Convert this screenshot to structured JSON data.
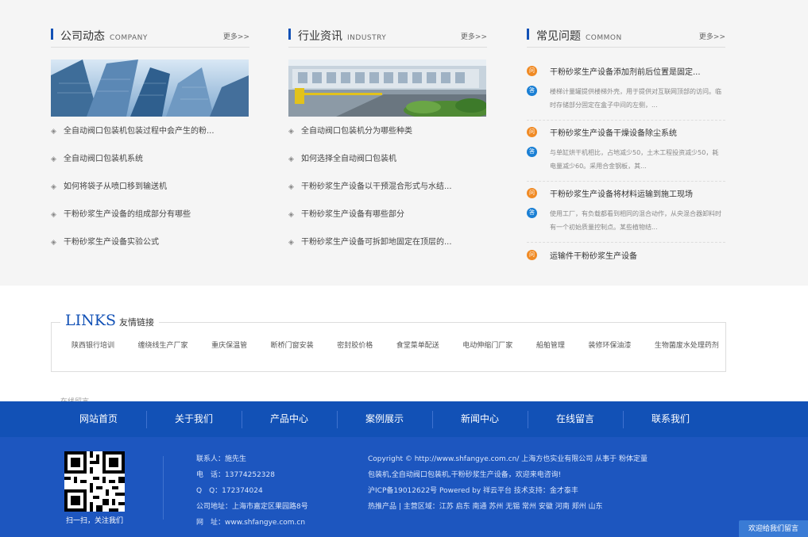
{
  "columns": [
    {
      "title": "公司动态",
      "title_en": "COMPANY",
      "more": "更多>>",
      "items": [
        "全自动阀口包装机包装过程中会产生的粉...",
        "全自动阀口包装机系统",
        "如何将袋子从喷口移到输送机",
        "干粉砂浆生产设备的组成部分有哪些",
        "干粉砂浆生产设备实验公式"
      ]
    },
    {
      "title": "行业资讯",
      "title_en": "INDUSTRY",
      "more": "更多>>",
      "items": [
        "全自动阀口包装机分为哪些种类",
        "如何选择全自动阀口包装机",
        "干粉砂浆生产设备以干预混合形式与水结...",
        "干粉砂浆生产设备有哪些部分",
        "干粉砂浆生产设备可拆卸地固定在顶层的..."
      ]
    }
  ],
  "faq": {
    "title": "常见问题",
    "title_en": "COMMON",
    "more": "更多>>",
    "q_badge": "问",
    "a_badge": "答",
    "items": [
      {
        "q": "干粉砂浆生产设备添加剂前后位置是固定...",
        "a": "楼梯计量罐提供楼梯外壳，用于提供对互联网顶部的访问。临时存储部分固定在盒子中间的左侧，..."
      },
      {
        "q": "干粉砂浆生产设备干燥设备除尘系统",
        "a": "与单缸烘干机相比，占地减少50，土木工程投资减少50，耗电量减少60。采用合金钢板，其..."
      },
      {
        "q": "干粉砂浆生产设备将材料运输到施工现场",
        "a": "使用工厂，有负载都看到相同的混合动作，从央混合器卸料时有一个初始质量控制点。某些植物结..."
      }
    ],
    "last_q": "运输件干粉砂浆生产设备"
  },
  "links": {
    "title_en": "LINKS",
    "title_cn": "友情链接",
    "items": [
      "陕西银行培训",
      "缠绕线生产厂家",
      "重庆保温管",
      "断桥门窗安装",
      "密封胶价格",
      "食堂菜单配送",
      "电动伸缩门厂家",
      "船舶管理",
      "装修环保油漆",
      "生物菌废水处理药剂"
    ]
  },
  "site_map": "在线留言",
  "footer": {
    "nav": [
      "网站首页",
      "关于我们",
      "产品中心",
      "案例展示",
      "新闻中心",
      "在线留言",
      "联系我们"
    ],
    "qr_caption": "扫一扫，关注我们",
    "contact": [
      "联系人：施先生",
      "电　话：13774252328",
      "Q　Q：172374024",
      "公司地址：上海市嘉定区果园路8号",
      "网　址：www.shfangye.com.cn"
    ],
    "copyright": [
      "Copyright © http://www.shfangye.com.cn/ 上海方也实业有限公司 从事于 粉体定量",
      "包装机,全自动阀口包装机,干粉砂浆生产设备，欢迎来电咨询!",
      "沪ICP备19012622号   Powered by 祥云平台   技术支持：金才泰丰",
      "热推产品  |   主营区域：江苏 启东 南通 苏州 无锡 常州 安徽 河南 郑州 山东"
    ]
  },
  "float_button": "欢迎给我们留言",
  "colors": {
    "brand_blue": "#1251b6",
    "footer_blue": "#1d56bf",
    "q_orange": "#f08a24",
    "a_blue": "#1a7fd4"
  }
}
